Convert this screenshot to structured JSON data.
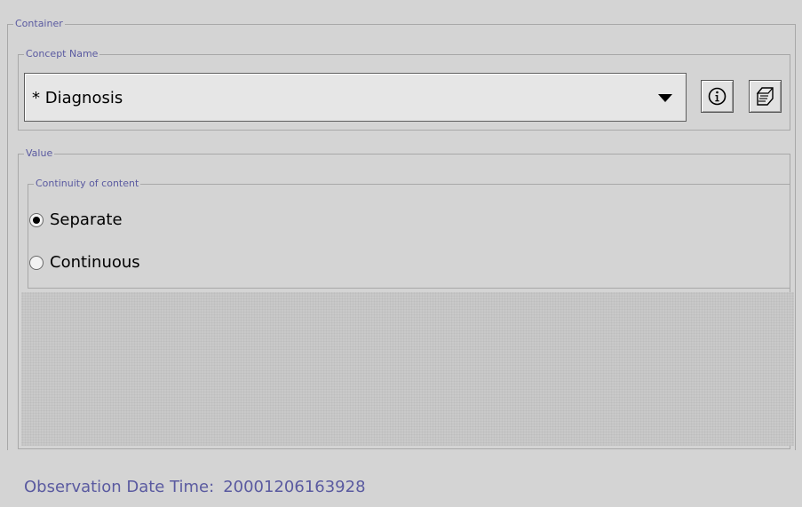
{
  "container": {
    "legend": "Container",
    "concept_name": {
      "legend": "Concept Name",
      "selected_value": "* Diagnosis",
      "buttons": {
        "info_icon": "info-icon",
        "edit_icon": "notepad-icon"
      }
    },
    "value": {
      "legend": "Value",
      "continuity": {
        "legend": "Continuity of content",
        "options": [
          {
            "label": "Separate",
            "selected": true
          },
          {
            "label": "Continuous",
            "selected": false
          }
        ]
      }
    }
  },
  "observation": {
    "label": "Observation Date Time:",
    "value": "20001206163928"
  },
  "colors": {
    "background": "#d4d4d4",
    "legend_text": "#5a5aa0",
    "border": "#a8a8a8"
  }
}
